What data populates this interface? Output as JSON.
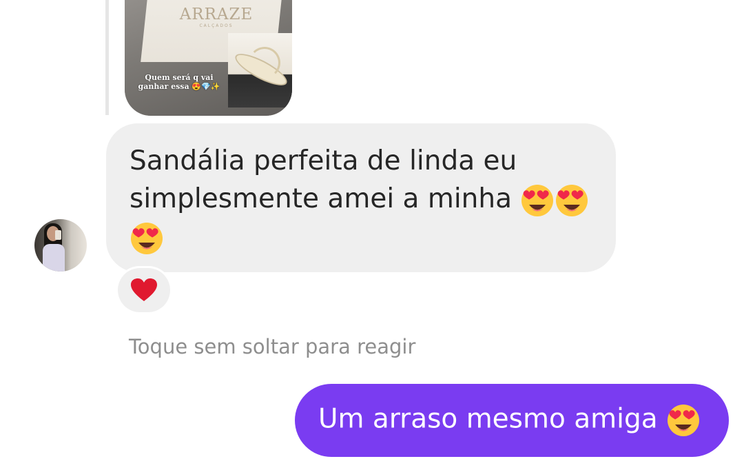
{
  "story_reply": {
    "brand": "ARRAZE",
    "brand_sub": "CALÇADOS",
    "caption": "Quem será q vai ganhar essa 😍💎✨"
  },
  "received_message": {
    "text": "Sandália perfeita de linda eu simplesmente amei a minha",
    "emoji_count": 3,
    "reaction": "heart"
  },
  "hint": "Toque sem soltar para reagir",
  "sent_message": {
    "text": "Um arraso mesmo amiga",
    "emoji_count": 1
  },
  "colors": {
    "sent_bubble": "#7a3cf1",
    "received_bubble": "#efefef",
    "hint_text": "#8e8e8e",
    "heart": "#e0192f"
  }
}
